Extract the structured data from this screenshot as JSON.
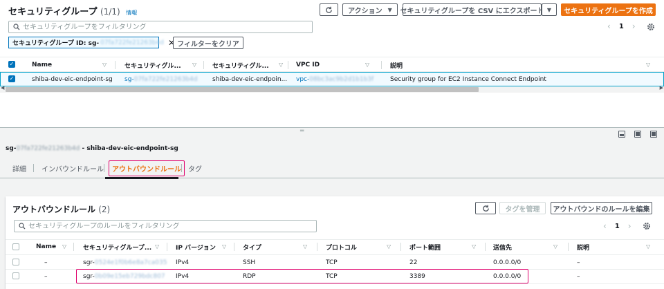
{
  "header": {
    "title": "セキュリティグループ",
    "count": "(1/1)",
    "info": "情報",
    "actions_label": "アクション",
    "export_label": "セキュリティグループを CSV にエクスポート",
    "create_label": "セキュリティグループを作成"
  },
  "search": {
    "placeholder": "セキュリティグループをフィルタリング"
  },
  "filter_token": {
    "label": "セキュリティグループ ID: sg-",
    "value": "07fa722fe21263b4d"
  },
  "clear_filter_label": "フィルターをクリア",
  "pagination": {
    "page": "1"
  },
  "table": {
    "columns": [
      "Name",
      "セキュリティグル...",
      "セキュリティグル...",
      "VPC ID",
      "説明"
    ],
    "row": {
      "name": "shiba-dev-eic-endpoint-sg",
      "sg_prefix": "sg-",
      "sg_id": "07fa722fe21263b4d",
      "group_name": "shiba-dev-eic-endpoin...",
      "vpc_prefix": "vpc-",
      "vpc_id": "08bc3ac9b2d1b1b3f",
      "description": "Security group for EC2 Instance Connect Endpoint"
    }
  },
  "detail": {
    "sg_prefix": "sg-",
    "sg_id": "07fa722fe21263b4d",
    "name_suffix": " - shiba-dev-eic-endpoint-sg",
    "tabs": [
      "詳細",
      "インバウンドルール",
      "アウトバウンドルール",
      "タグ"
    ]
  },
  "outbound": {
    "title": "アウトバウンドルール",
    "count": "(2)",
    "manage_tags_label": "タグを管理",
    "edit_label": "アウトバウンドのルールを編集",
    "search_placeholder": "セキュリティグループのルールをフィルタリング",
    "page": "1",
    "columns": [
      "Name",
      "セキュリティグループ...",
      "IP バージョン",
      "タイプ",
      "プロトコル",
      "ポート範囲",
      "送信先",
      "説明"
    ],
    "rows": [
      {
        "name": "–",
        "rule_prefix": "sgr-",
        "rule_id": "0524e1f0b6e8a7ca035",
        "ip": "IPv4",
        "type": "SSH",
        "protocol": "TCP",
        "port": "22",
        "dest": "0.0.0.0/0",
        "desc": "–"
      },
      {
        "name": "–",
        "rule_prefix": "sgr-",
        "rule_id": "0b09e15eb729bdc807",
        "ip": "IPv4",
        "type": "RDP",
        "protocol": "TCP",
        "port": "3389",
        "dest": "0.0.0.0/0",
        "desc": "–"
      }
    ]
  }
}
